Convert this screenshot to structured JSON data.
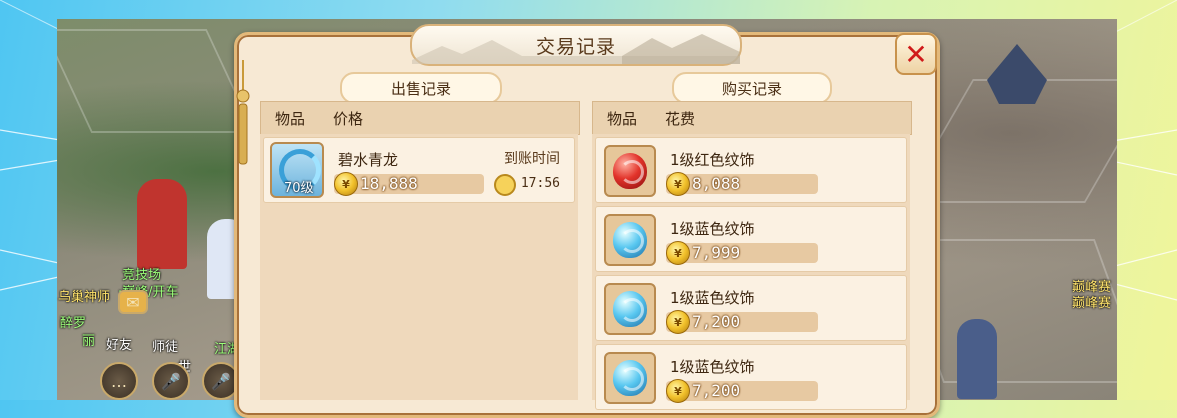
{
  "window": {
    "title": "交易记录",
    "close_icon": "close-icon"
  },
  "sell": {
    "tab_label": "出售记录",
    "col_item": "物品",
    "col_price": "价格",
    "items": [
      {
        "name": "碧水青龙",
        "level": "70级",
        "price": "18,888",
        "time_label": "到账时间",
        "time": "17:56",
        "icon": "dragon-pet-icon"
      }
    ]
  },
  "buy": {
    "tab_label": "购买记录",
    "col_item": "物品",
    "col_cost": "花费",
    "items": [
      {
        "name": "1级红色纹饰",
        "price": "8,088",
        "icon": "red-gem-icon"
      },
      {
        "name": "1级蓝色纹饰",
        "price": "7,999",
        "icon": "blue-gem-icon"
      },
      {
        "name": "1级蓝色纹饰",
        "price": "7,200",
        "icon": "blue-gem-icon"
      },
      {
        "name": "1级蓝色纹饰",
        "price": "7,200",
        "icon": "blue-gem-icon"
      }
    ]
  },
  "hud": {
    "npc_left": "乌巢神师",
    "arena_text": "竞技场",
    "arena_sub": "·巅峰/开车",
    "friends_label": "好友",
    "mentor_label": "师徒",
    "chat_label": "世",
    "npc_left2": "醉罗",
    "npc_left3": "丽",
    "npc_right": "巅峰赛",
    "npc_right2": "巅峰赛",
    "jianghu": "江湖"
  },
  "colors": {
    "accent": "#d01a1a",
    "panel_bg": "#f7e9d4",
    "border": "#e3b97a",
    "coin": "#f2c12b"
  }
}
